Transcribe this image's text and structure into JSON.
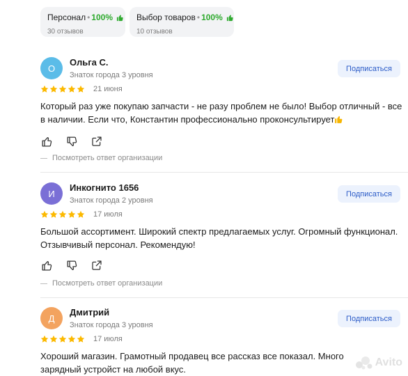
{
  "aspects": [
    {
      "name": "Персонал",
      "percent": "100%",
      "reviews": "30 отзывов"
    },
    {
      "name": "Выбор товаров",
      "percent": "100%",
      "reviews": "10 отзывов"
    }
  ],
  "reviews": [
    {
      "initial": "О",
      "avatar_color": "#5bbce8",
      "author": "Ольга С.",
      "level": "Знаток города 3 уровня",
      "subscribe_label": "Подписаться",
      "stars": 5,
      "date": "21 июня",
      "text": "Который раз уже покупаю запчасти - не разу проблем не было! Выбор отличный - все в наличии. Если что, Константин профессионально проконсультирует",
      "text_emoji": "thumbs-up",
      "reply_label": "Посмотреть ответ организации"
    },
    {
      "initial": "И",
      "avatar_color": "#7a6fd6",
      "author": "Инкогнито 1656",
      "level": "Знаток города 2 уровня",
      "subscribe_label": "Подписаться",
      "stars": 5,
      "date": "17 июля",
      "text": "Большой ассортимент. Широкий спектр предлагаемых услуг. Огромный функционал. Отзывчивый персонал. Рекомендую!",
      "reply_label": "Посмотреть ответ организации"
    },
    {
      "initial": "Д",
      "avatar_color": "#f3a35f",
      "author": "Дмитрий",
      "level": "Знаток города 3 уровня",
      "subscribe_label": "Подписаться",
      "stars": 5,
      "date": "17 июля",
      "text": "Хороший магазин. Грамотный продавец все рассказ все показал. Много зарядный устройст на любой вкус."
    }
  ],
  "colors": {
    "star": "#fcb900",
    "accent": "#2b5bc7",
    "positive": "#2eaa2e"
  },
  "watermark": "Avito"
}
